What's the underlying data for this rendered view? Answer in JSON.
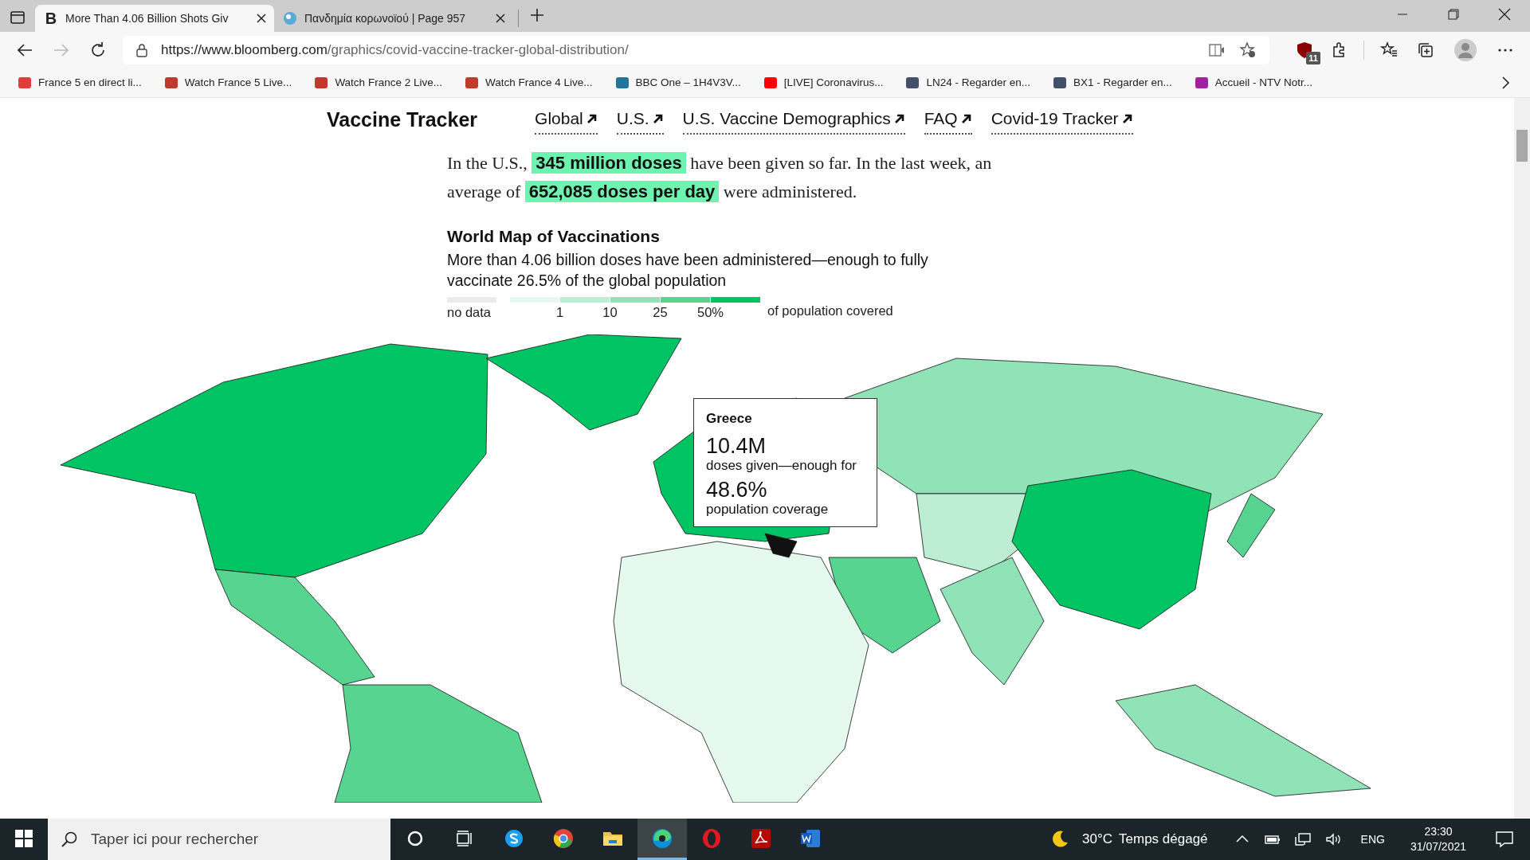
{
  "browser": {
    "tabs": [
      {
        "icon_letter": "B",
        "title": "More Than 4.06 Billion Shots Giv",
        "selected": true
      },
      {
        "title": "Πανδημία κορωνοϊού | Page 957",
        "selected": false
      }
    ],
    "url": {
      "host": "https://www.bloomberg.com",
      "path": "/graphics/covid-vaccine-tracker-global-distribution/"
    },
    "extension_badge": "11",
    "bookmarks": [
      {
        "title": "France 5 en direct li..."
      },
      {
        "title": "Watch France 5 Live..."
      },
      {
        "title": "Watch France 2 Live..."
      },
      {
        "title": "Watch France 4 Live..."
      },
      {
        "title": "BBC One – 1H4V3V..."
      },
      {
        "title": "[LIVE] Coronavirus..."
      },
      {
        "title": "LN24 - Regarder en..."
      },
      {
        "title": "BX1 - Regarder en..."
      },
      {
        "title": "Accueil - NTV Notr..."
      }
    ]
  },
  "page": {
    "brand": "Vaccine Tracker",
    "nav": [
      "Global",
      "U.S.",
      "U.S. Vaccine Demographics",
      "FAQ",
      "Covid-19 Tracker"
    ],
    "summary": [
      [
        {
          "text": "In the U.S.,",
          "highlight": false
        },
        {
          "text": "345 million doses",
          "highlight": true
        },
        {
          "text": "have been given so far. In the last week, an",
          "highlight": false
        }
      ],
      [
        {
          "text": "average of",
          "highlight": false
        },
        {
          "text": "652,085 doses per day",
          "highlight": true
        },
        {
          "text": "were administered.",
          "highlight": false
        }
      ]
    ],
    "map": {
      "title": "World Map of Vaccinations",
      "subtitle": "More than 4.06 billion doses have been administered—enough to fully vaccinate 26.5% of the global population",
      "legend": {
        "no_data": {
          "label": "no data",
          "color": "#ebebeb"
        },
        "swatches": [
          {
            "color": "#e6f9ef"
          },
          {
            "color": "#bdeed3"
          },
          {
            "color": "#8fe3b6"
          },
          {
            "color": "#57d48f"
          },
          {
            "color": "#00c364"
          }
        ],
        "ticks": [
          "1",
          "10",
          "25",
          "50%"
        ],
        "unit": "of population covered"
      },
      "tooltip": {
        "country": "Greece",
        "doses": "10.4M",
        "doses_label": "doses given—enough for",
        "coverage": "48.6%",
        "coverage_label": "population coverage"
      }
    }
  },
  "taskbar": {
    "search_placeholder": "Taper ici pour rechercher",
    "apps": [
      {
        "kind": "cortana",
        "selected": false
      },
      {
        "kind": "taskview",
        "selected": false
      },
      {
        "kind": "skype",
        "selected": false
      },
      {
        "kind": "chrome",
        "selected": false
      },
      {
        "kind": "explorer",
        "selected": false
      },
      {
        "kind": "edge",
        "selected": true
      },
      {
        "kind": "opera",
        "selected": false
      },
      {
        "kind": "acrobat",
        "selected": false
      },
      {
        "kind": "word",
        "selected": false
      }
    ],
    "temperature": "30°C",
    "weather": "Temps dégagé",
    "language": "ENG",
    "time": "23:30",
    "date": "31/07/2021"
  }
}
